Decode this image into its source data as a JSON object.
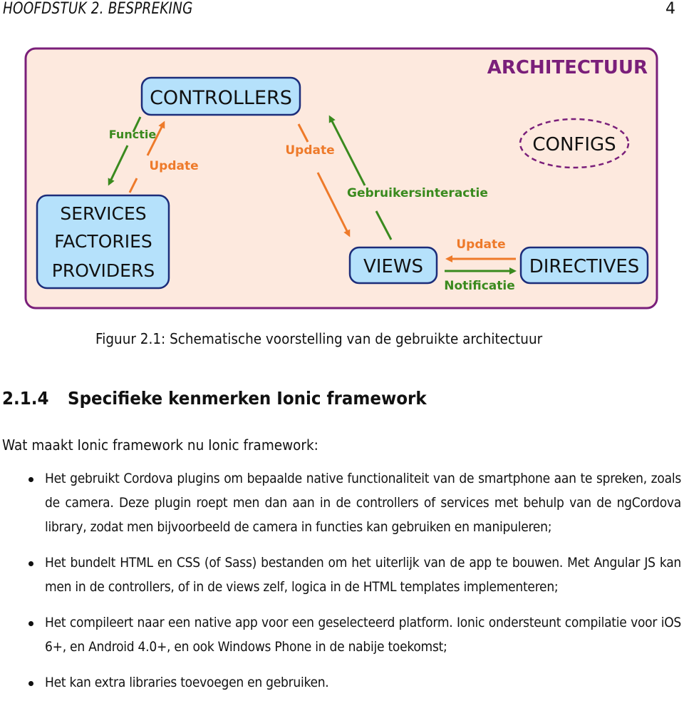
{
  "header": {
    "running_head": "HOOFDSTUK 2.  BESPREKING",
    "page_number": "4"
  },
  "figure": {
    "title": "ARCHITECTUUR",
    "nodes": {
      "controllers": "CONTROLLERS",
      "services": [
        "SERVICES",
        "FACTORIES",
        "PROVIDERS"
      ],
      "configs": "CONFIGS",
      "views": "VIEWS",
      "directives": "DIRECTIVES"
    },
    "edges": {
      "controllers_to_services": "Functie",
      "services_to_controllers": "Update",
      "controllers_to_views": "Update",
      "views_to_controllers": "Gebruikersinteractie",
      "directives_to_views": "Update",
      "views_to_directives": "Notificatie"
    },
    "colors": {
      "frame_border": "#7a1f7a",
      "frame_fill": "#fde9de",
      "title": "#7a1f7a",
      "box_fill": "#b5e1fb",
      "box_border": "#1c2d7a",
      "orange": "#ee7a2a",
      "green": "#3a8a1e",
      "configs_dash": "#7a1f7a"
    }
  },
  "caption": "Figuur 2.1: Schematische voorstelling van de gebruikte architectuur",
  "section": {
    "number": "2.1.4",
    "title": "Specifieke kenmerken Ionic framework"
  },
  "intro": "Wat maakt Ionic framework nu Ionic framework:",
  "bullets": [
    "Het gebruikt Cordova plugins om bepaalde native functionaliteit van de smartphone aan te spreken, zoals de camera. Deze plugin roept men dan aan in de controllers of services met behulp van de ngCordova library, zodat men bijvoorbeeld de camera in functies kan gebruiken en manipuleren;",
    "Het bundelt HTML en CSS (of Sass) bestanden om het uiterlijk van de app te bouwen. Met Angular JS kan men in de controllers, of in de views zelf, logica in de HTML templates implementeren;",
    "Het compileert naar een native app voor een geselecteerd platform. Ionic ondersteunt compilatie voor iOS 6+, en Android 4.0+, en ook Windows Phone in de nabije toekomst;",
    "Het kan extra libraries toevoegen en gebruiken."
  ]
}
